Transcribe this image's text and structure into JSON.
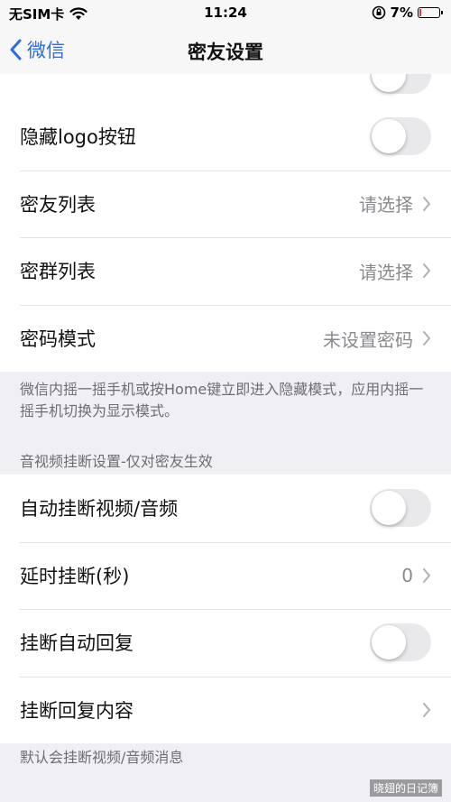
{
  "status_bar": {
    "carrier": "无SIM卡",
    "time": "11:24",
    "battery_percent": "7%",
    "icons": [
      "wifi-icon",
      "orientation-lock-icon",
      "battery-icon"
    ]
  },
  "nav": {
    "back_label": "微信",
    "title": "密友设置"
  },
  "group1": {
    "items": [
      {
        "label": "隐藏logo按钮",
        "type": "toggle",
        "on": false
      },
      {
        "label": "密友列表",
        "value": "请选择",
        "type": "link"
      },
      {
        "label": "密群列表",
        "value": "请选择",
        "type": "link"
      },
      {
        "label": "密码模式",
        "value": "未设置密码",
        "type": "link"
      }
    ],
    "footnote": "微信内摇一摇手机或按Home键立即进入隐藏模式，应用内摇一摇手机切换为显示模式。"
  },
  "group2": {
    "header": "音视频挂断设置-仅对密友生效",
    "items": [
      {
        "label": "自动挂断视频/音频",
        "type": "toggle",
        "on": false
      },
      {
        "label": "延时挂断(秒)",
        "value": "0",
        "type": "link"
      },
      {
        "label": "挂断自动回复",
        "type": "toggle",
        "on": false
      },
      {
        "label": "挂断回复内容",
        "value": "",
        "type": "link"
      }
    ],
    "footnote": "默认会挂断视频/音频消息"
  },
  "watermark": "晓翅的日记簿",
  "colors": {
    "accent": "#2b6de0",
    "background": "#efeff4",
    "toggle_off": "#e9e9eb",
    "battery_low": "#e53935"
  }
}
